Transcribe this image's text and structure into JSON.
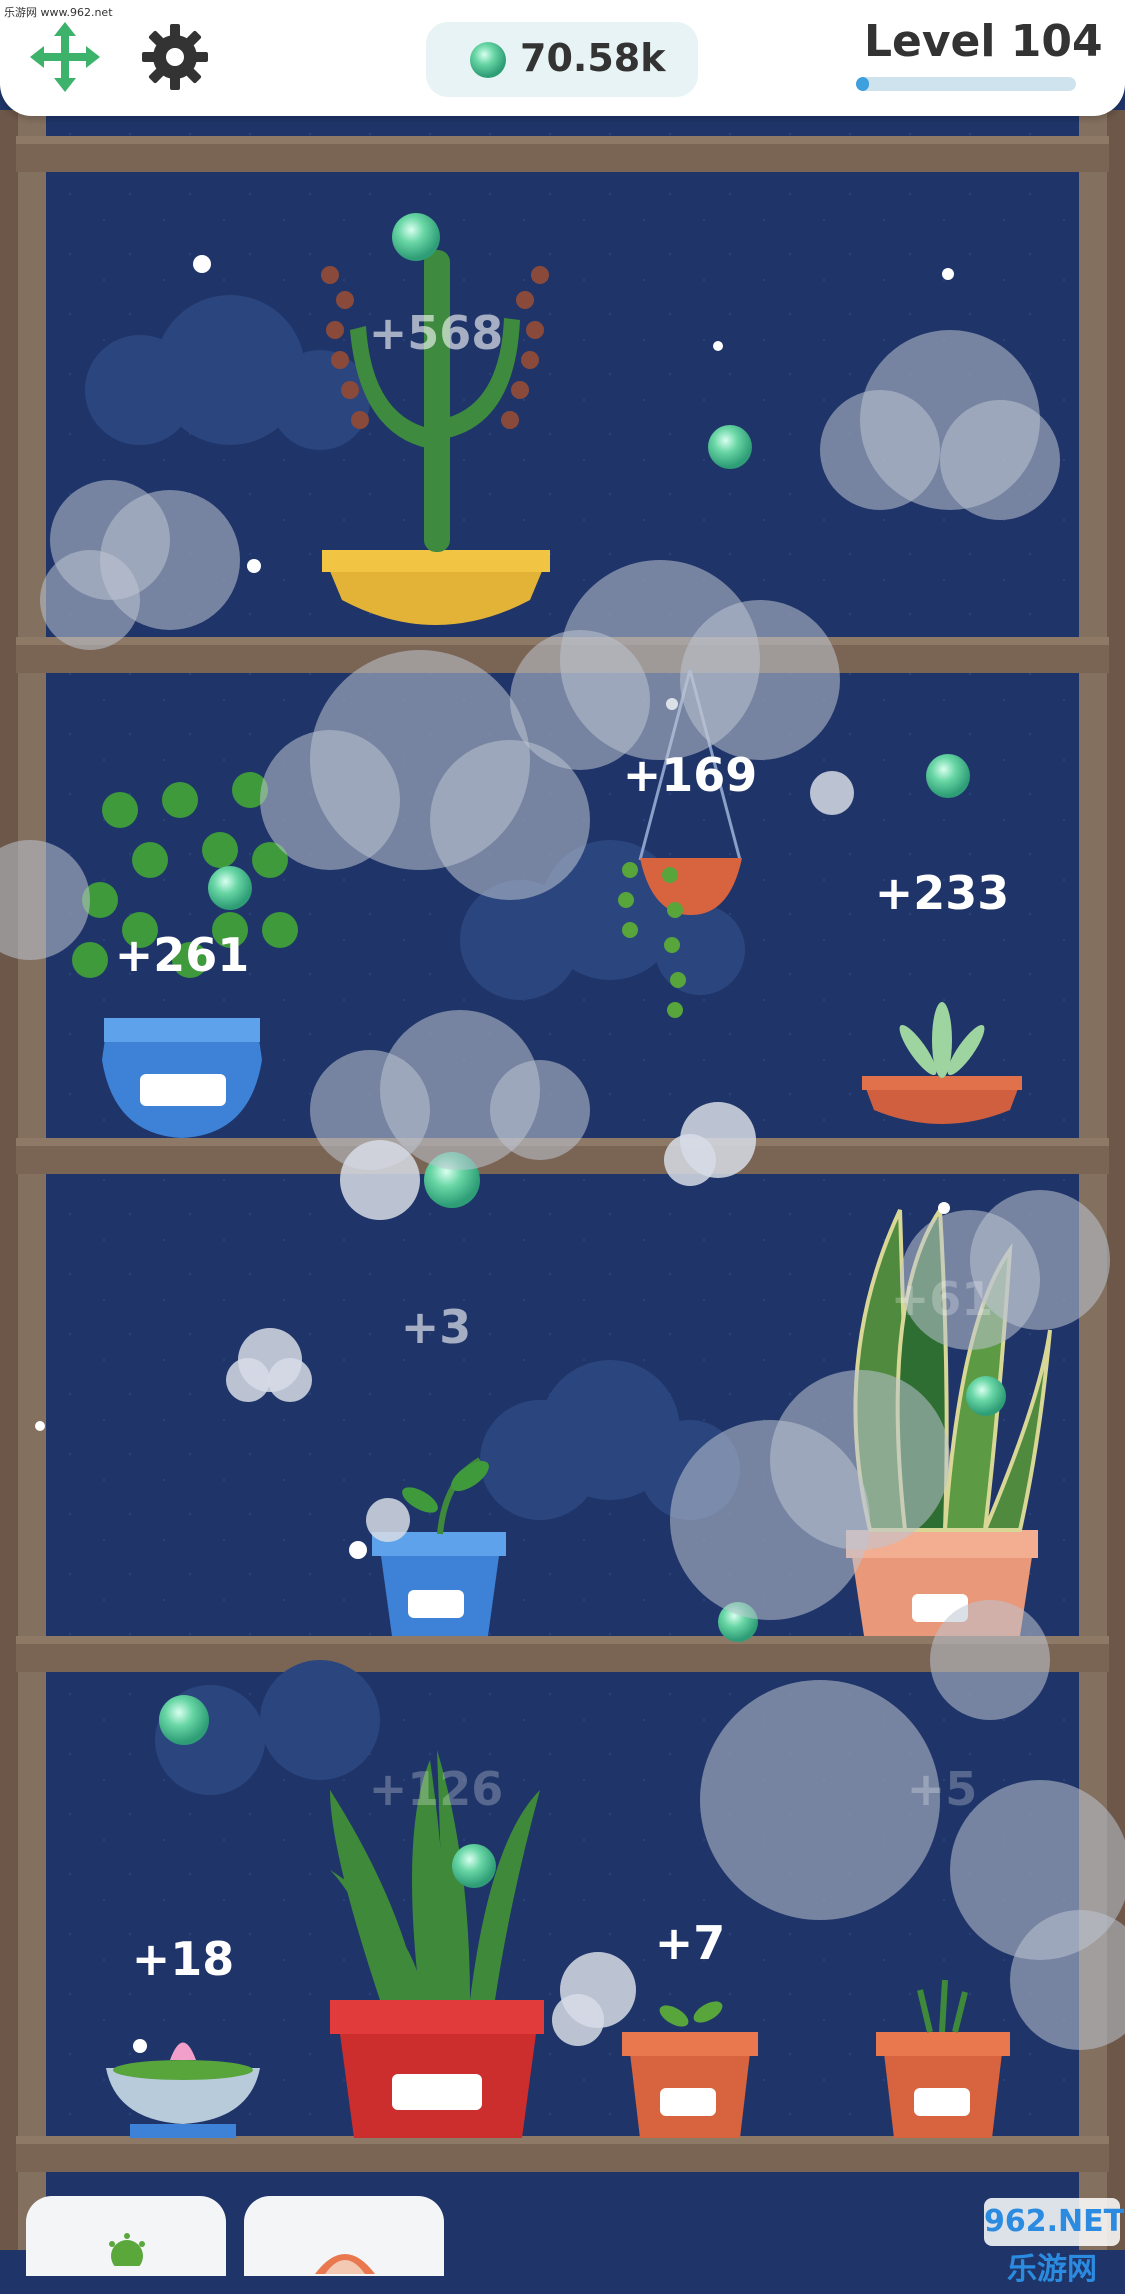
{
  "watermark": "乐游网 www.962.net",
  "hud": {
    "currency_value": "70.58k",
    "currency_icon": "green-gem-icon",
    "level_label": "Level 104",
    "level_progress": 0.06,
    "accent_color": "#3ea0dc"
  },
  "toolbar": {
    "move_icon": "move-arrows-icon",
    "settings_icon": "gear-icon"
  },
  "plants": [
    {
      "name": "Flowering cactus",
      "income": "+568",
      "shelf": 1
    },
    {
      "name": "Fern",
      "income": "+261",
      "shelf": 2
    },
    {
      "name": "Hanging plant",
      "income": "+169",
      "shelf": 2
    },
    {
      "name": "Succulent",
      "income": "+233",
      "shelf": 2
    },
    {
      "name": "Sprout",
      "income": "+3",
      "shelf": 3
    },
    {
      "name": "Snake plant",
      "income": "+61",
      "shelf": 3
    },
    {
      "name": "Aloe",
      "income": "+126",
      "shelf": 4
    },
    {
      "name": "Lotus bowl",
      "income": "+18",
      "shelf": 4
    },
    {
      "name": "Seedling",
      "income": "+7",
      "shelf": 4
    },
    {
      "name": "Grass pot",
      "income": "+5",
      "shelf": 4
    }
  ],
  "bottom_tabs": [
    {
      "icon": "virus-bug-icon"
    },
    {
      "icon": "orange-item-icon"
    }
  ],
  "corner_logo": "962.NET 乐游网"
}
